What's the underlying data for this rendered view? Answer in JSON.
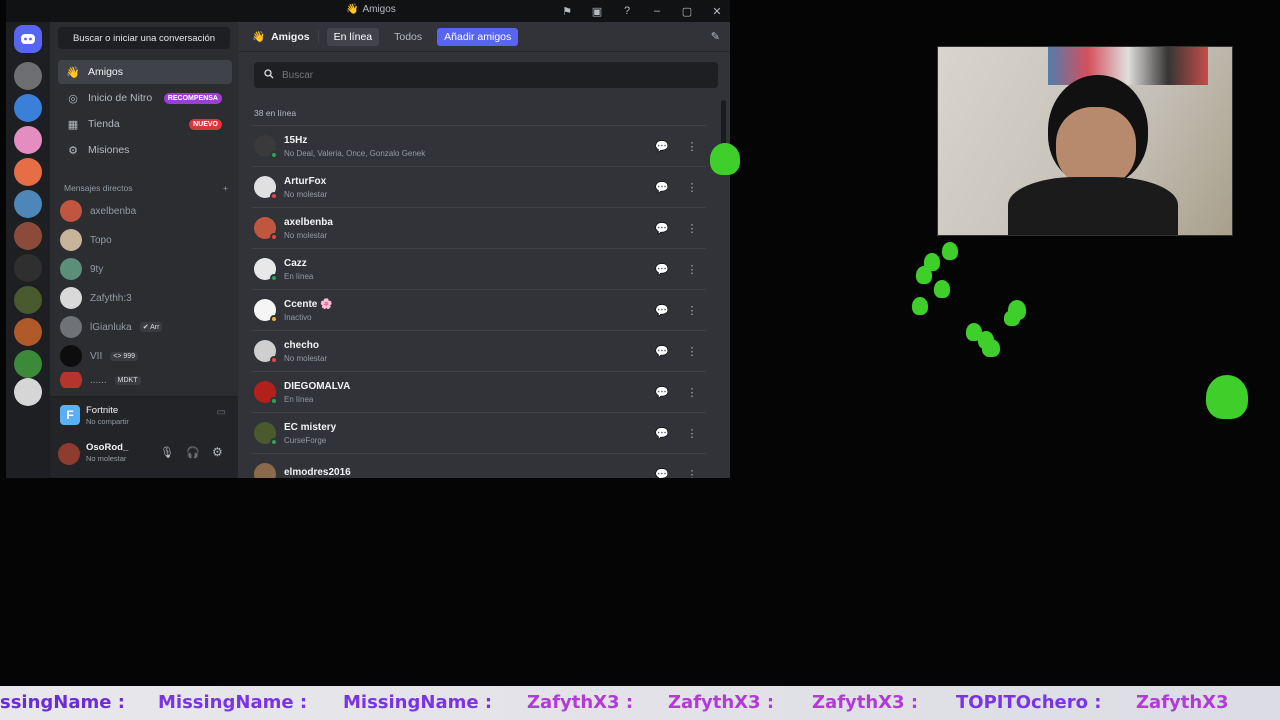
{
  "window": {
    "title": "Amigos"
  },
  "sidebar": {
    "search_label": "Buscar o iniciar una conversación",
    "items": [
      {
        "label": "Amigos",
        "icon": "friends-icon"
      },
      {
        "label": "Inicio de Nitro",
        "icon": "nitro-icon",
        "badge": "RECOMPENSA"
      },
      {
        "label": "Tienda",
        "icon": "shop-icon",
        "badge": "NUEVO"
      },
      {
        "label": "Misiones",
        "icon": "quests-icon"
      }
    ],
    "dm_header": "Mensajes directos",
    "dms": [
      {
        "name": "axelbenba"
      },
      {
        "name": "Topo"
      },
      {
        "name": "9ty"
      },
      {
        "name": "Zafythh:3"
      },
      {
        "name": "lGianluka",
        "tag": "✔ Arr"
      },
      {
        "name": "VII",
        "tag": "<> 999"
      },
      {
        "name": "......",
        "tag": "MDKT"
      }
    ],
    "activity": {
      "game": "Fortnite",
      "sub": "No compartir"
    },
    "user": {
      "name": "OsoRod_",
      "status": "No molestar"
    }
  },
  "main": {
    "header": {
      "title": "Amigos",
      "tabs": [
        "En línea",
        "Todos"
      ],
      "add_label": "Añadir amigos"
    },
    "search_placeholder": "Buscar",
    "online_count": "38 en línea",
    "friends": [
      {
        "name": "15Hz",
        "status": "No Deal, Valeria, Once, Gonzalo Genek",
        "color": "#23a55a"
      },
      {
        "name": "ArturFox",
        "status": "No molestar",
        "color": "#f23f43"
      },
      {
        "name": "axelbenba",
        "status": "No molestar",
        "color": "#f23f43"
      },
      {
        "name": "Cazz",
        "status": "En línea",
        "color": "#23a55a"
      },
      {
        "name": "Ccente 🌸",
        "status": "Inactivo",
        "color": "#f0b232"
      },
      {
        "name": "checho",
        "status": "No molestar",
        "color": "#f23f43"
      },
      {
        "name": "DIEGOMALVA",
        "status": "En línea",
        "color": "#23a55a"
      },
      {
        "name": "EC mistery",
        "status": "CurseForge",
        "color": "#23a55a"
      },
      {
        "name": "elmodres2016",
        "status": "",
        "color": "#23a55a"
      }
    ]
  },
  "ticker": [
    {
      "text": "ssingName :",
      "color": "#6b2bd9"
    },
    {
      "text": "MissingName :",
      "color": "#7a34e6"
    },
    {
      "text": "MissingName :",
      "color": "#7a34e6"
    },
    {
      "text": "ZafythX3 :",
      "color": "#b23ad8"
    },
    {
      "text": "ZafythX3 :",
      "color": "#b23ad8"
    },
    {
      "text": "ZafythX3 :",
      "color": "#b23ad8"
    },
    {
      "text": "TOPITOchero :",
      "color": "#7a34e6"
    },
    {
      "text": "ZafythX3",
      "color": "#b23ad8"
    }
  ]
}
